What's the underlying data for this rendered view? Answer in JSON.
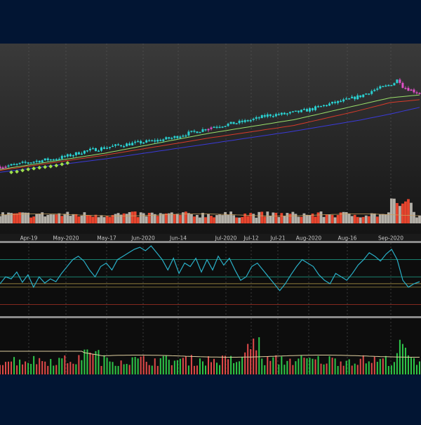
{
  "colors": {
    "frame": "#021533",
    "price_panel_top": "#3a3a3a",
    "price_panel_bottom": "#141414",
    "panel_bg": "#0d0d0d",
    "separator": "#8a8a8a",
    "candle_up": "#2ad0d0",
    "candle_down": "#e050c8",
    "signal_marker": "#9ee04a",
    "ma_fast": "#9ae06a",
    "ma_mid": "#d83a2a",
    "ma_slow": "#3a3ad8",
    "volume_gray": "#b4b0a8",
    "volume_red": "#e8452e",
    "volume_avg_line": "#c8a060",
    "osc_line": "#2ab0c8",
    "osc_level_green": "#1ea890",
    "osc_level_yellow": "#b8a04a",
    "osc_level_red": "#c83a2a",
    "hist_green": "#2ec84a",
    "hist_red": "#e04a4a",
    "hist_avg_line": "#e0d0a0",
    "gridline": "#5a5a5a",
    "axis_text": "#c8c8c8"
  },
  "chart_data": [
    {
      "type": "candlestick",
      "panel": "price",
      "title": "",
      "xlabel": "",
      "ylabel": "",
      "period": [
        "Apr 2020",
        "Sep 2020"
      ],
      "x_tick_labels": [
        "Apr-19",
        "May-2020",
        "May-17",
        "Jun-2020",
        "Jun-14",
        "Jul-2020",
        "Jul-12",
        "Jul-21",
        "Aug-2020",
        "Aug-16",
        "Sep-2020"
      ],
      "vertical_gridlines": true,
      "note_scale": "relative, 0 = low of window, 100 = high of window",
      "close_path": [
        [
          0,
          8
        ],
        [
          4,
          10
        ],
        [
          6,
          12
        ],
        [
          9,
          14
        ],
        [
          13,
          16
        ],
        [
          17,
          20
        ],
        [
          20,
          24
        ],
        [
          24,
          27
        ],
        [
          28,
          30
        ],
        [
          33,
          33
        ],
        [
          37,
          35
        ],
        [
          41,
          38
        ],
        [
          44,
          42
        ],
        [
          47,
          45
        ],
        [
          51,
          50
        ],
        [
          54,
          52
        ],
        [
          58,
          55
        ],
        [
          61,
          58
        ],
        [
          64,
          62
        ],
        [
          68,
          63
        ],
        [
          72,
          66
        ],
        [
          75,
          69
        ],
        [
          78,
          73
        ],
        [
          82,
          77
        ],
        [
          86,
          82
        ],
        [
          89,
          88
        ],
        [
          92,
          92
        ],
        [
          94,
          96
        ],
        [
          95,
          100
        ],
        [
          96,
          92
        ],
        [
          98,
          88
        ],
        [
          100,
          85
        ]
      ],
      "down_candle_zones": [
        [
          0,
          2
        ],
        [
          49,
          51
        ],
        [
          95,
          100
        ]
      ],
      "moving_averages": {
        "ma_fast": [
          [
            0,
            5
          ],
          [
            25,
            22
          ],
          [
            50,
            43
          ],
          [
            70,
            57
          ],
          [
            85,
            72
          ],
          [
            93,
            80
          ],
          [
            100,
            83
          ]
        ],
        "ma_mid": [
          [
            0,
            4
          ],
          [
            25,
            20
          ],
          [
            50,
            38
          ],
          [
            70,
            51
          ],
          [
            85,
            66
          ],
          [
            93,
            75
          ],
          [
            100,
            78
          ]
        ],
        "ma_slow": [
          [
            0,
            2
          ],
          [
            25,
            16
          ],
          [
            50,
            32
          ],
          [
            70,
            45
          ],
          [
            85,
            56
          ],
          [
            93,
            63
          ],
          [
            100,
            70
          ]
        ]
      }
    },
    {
      "type": "bar",
      "panel": "volume",
      "title": "",
      "pattern": "mostly gray bars with red spikes, tallest near Sep-2020",
      "highlight_region": [
        93,
        98
      ]
    },
    {
      "type": "line",
      "panel": "oscillator",
      "title": "",
      "ylim": [
        0,
        100
      ],
      "levels": [
        80,
        55,
        45,
        40,
        15
      ],
      "values": [
        45,
        55,
        52,
        62,
        47,
        58,
        40,
        55,
        46,
        52,
        48,
        60,
        70,
        80,
        85,
        78,
        65,
        55,
        70,
        75,
        65,
        80,
        85,
        90,
        95,
        98,
        93,
        100,
        90,
        80,
        65,
        82,
        60,
        75,
        70,
        82,
        62,
        80,
        65,
        85,
        72,
        82,
        65,
        50,
        55,
        70,
        75,
        65,
        55,
        45,
        35,
        45,
        58,
        70,
        80,
        75,
        70,
        58,
        50,
        45,
        60,
        55,
        50,
        60,
        72,
        80,
        90,
        85,
        78,
        88,
        95,
        80,
        50,
        40,
        45,
        48
      ]
    },
    {
      "type": "bar",
      "panel": "histogram",
      "title": "",
      "pattern": "green and red bars around an average line; large red spikes near Sep-2020"
    }
  ]
}
